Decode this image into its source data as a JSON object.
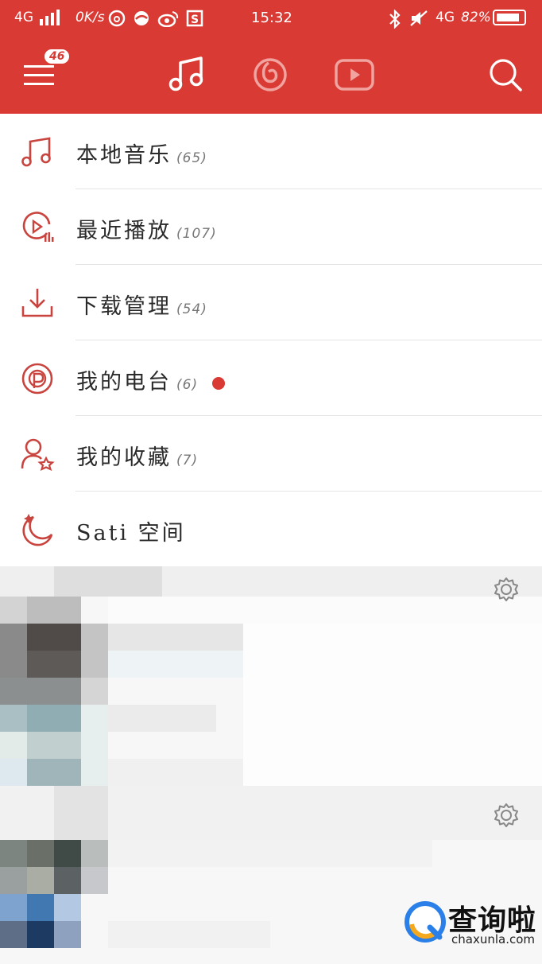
{
  "status_bar": {
    "network": "4G",
    "speed": "0K/s",
    "time": "15:32",
    "net2": "4G",
    "battery": "82%"
  },
  "header": {
    "menu_badge": "46",
    "colors": {
      "bar": "#d93a34",
      "accent": "#d93a34"
    },
    "tabs": [
      {
        "icon": "music-note-icon",
        "active": true
      },
      {
        "icon": "radio-disc-icon",
        "active": false
      },
      {
        "icon": "video-play-icon",
        "active": false
      }
    ]
  },
  "menu": {
    "items": [
      {
        "label": "本地音乐",
        "count": "(65)",
        "icon": "music-note-icon"
      },
      {
        "label": "最近播放",
        "count": "(107)",
        "icon": "recent-play-icon"
      },
      {
        "label": "下载管理",
        "count": "(54)",
        "icon": "download-icon"
      },
      {
        "label": "我的电台",
        "count": "(6)",
        "icon": "radio-station-icon",
        "has_dot": true
      },
      {
        "label": "我的收藏",
        "count": "(7)",
        "icon": "user-star-icon"
      },
      {
        "label": "Sati 空间",
        "count": "",
        "icon": "moon-icon"
      }
    ]
  },
  "watermark": {
    "title": "查询啦",
    "subtitle": "chaxunla.com"
  }
}
